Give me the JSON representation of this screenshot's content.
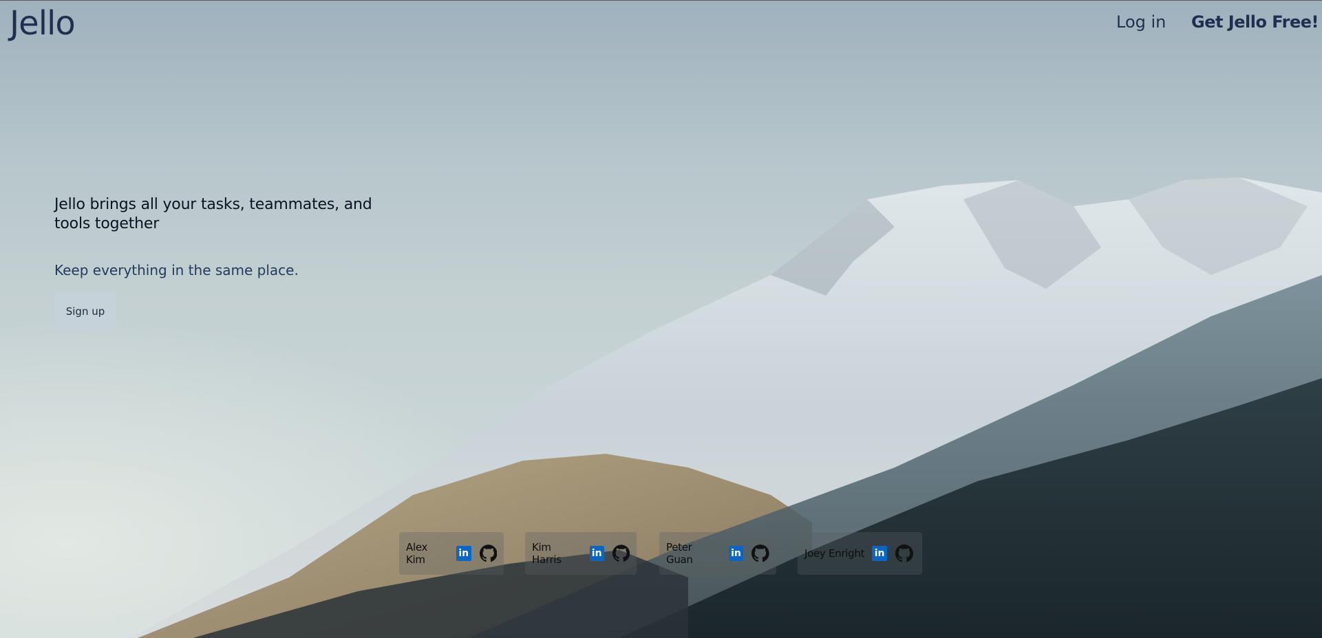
{
  "navbar": {
    "logo": "Jello",
    "login_label": "Log in",
    "get_free_label": "Get Jello Free!"
  },
  "hero": {
    "title": "Jello brings all your tasks, teammates, and tools together",
    "subtitle": "Keep everything in the same place.",
    "signup_label": "Sign up"
  },
  "team": [
    {
      "name": "Alex Kim",
      "icons": [
        "linkedin-icon",
        "github-icon"
      ]
    },
    {
      "name": "Kim Harris",
      "icons": [
        "linkedin-icon",
        "github-icon"
      ]
    },
    {
      "name": "Peter Guan",
      "icons": [
        "linkedin-icon",
        "github-icon"
      ]
    },
    {
      "name": "Joey Enright",
      "icons": [
        "linkedin-icon",
        "github-icon"
      ]
    }
  ],
  "colors": {
    "brand_navy": "#1e2f50",
    "linkedin_blue": "#0a66c2"
  }
}
